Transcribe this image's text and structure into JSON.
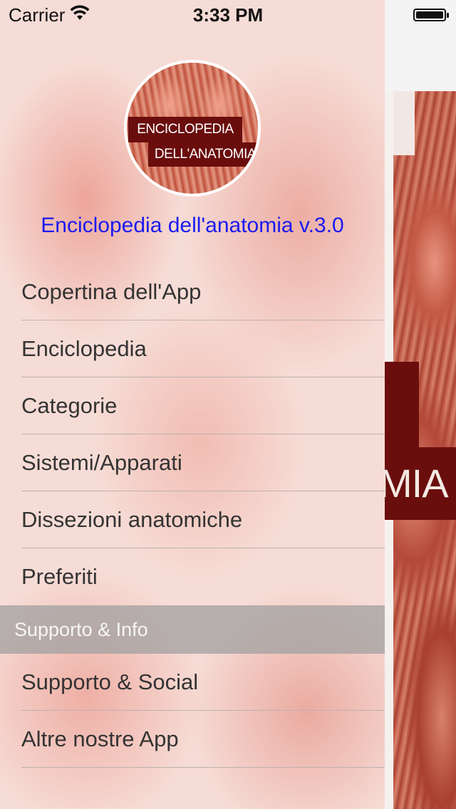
{
  "status_bar": {
    "carrier": "Carrier",
    "time": "3:33 PM",
    "wifi_icon": "wifi-icon",
    "battery_icon": "battery-icon",
    "battery_level": 1.0
  },
  "logo": {
    "line1": "ENCICLOPEDIA",
    "line2": "DELL'ANATOMIA"
  },
  "app_title": "Enciclopedia dell'anatomia v.3.0",
  "menu": {
    "items": [
      {
        "label": "Copertina dell'App"
      },
      {
        "label": "Enciclopedia"
      },
      {
        "label": "Categorie"
      },
      {
        "label": "Sistemi/Apparati"
      },
      {
        "label": "Dissezioni anatomiche"
      },
      {
        "label": "Preferiti"
      }
    ],
    "section_header": "Supporto & Info",
    "support_items": [
      {
        "label": "Supporto & Social"
      },
      {
        "label": "Altre nostre App"
      }
    ]
  },
  "background_screen": {
    "title_fragment": "MIA"
  },
  "colors": {
    "app_title": "#1a1af0",
    "brand_dark_red": "#6a0d0d",
    "section_header_bg": "#a0a0a0"
  }
}
